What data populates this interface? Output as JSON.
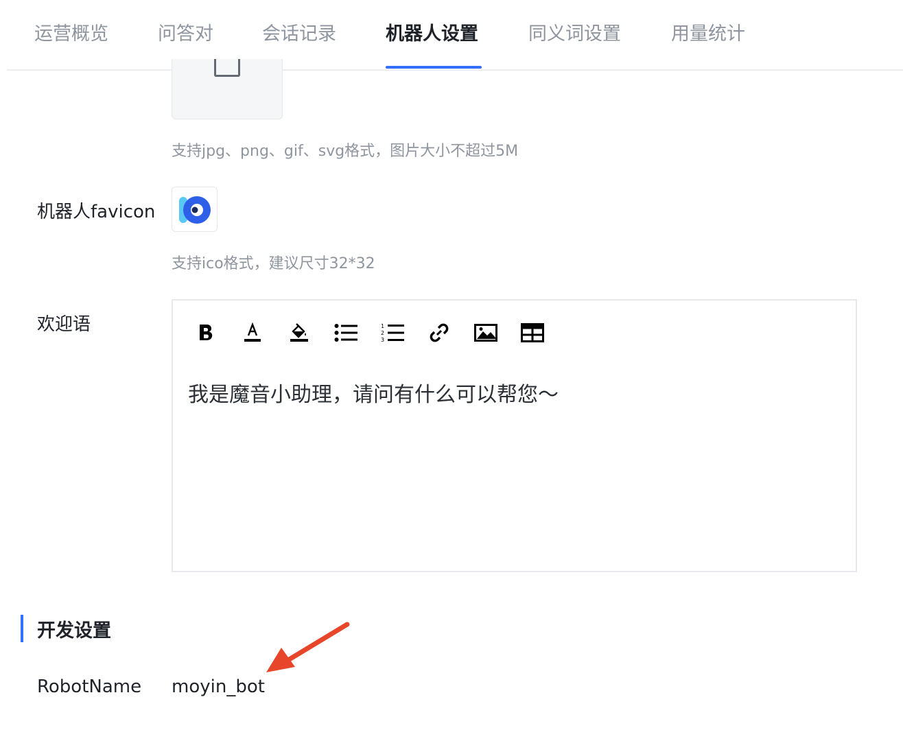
{
  "tabs": [
    {
      "label": "运营概览",
      "active": false
    },
    {
      "label": "问答对",
      "active": false
    },
    {
      "label": "会话记录",
      "active": false
    },
    {
      "label": "机器人设置",
      "active": true
    },
    {
      "label": "同义词设置",
      "active": false
    },
    {
      "label": "用量统计",
      "active": false
    }
  ],
  "avatar_upload": {
    "hint": "支持jpg、png、gif、svg格式，图片大小不超过5M"
  },
  "favicon": {
    "label": "机器人favicon",
    "hint": "支持ico格式，建议尺寸32*32"
  },
  "welcome": {
    "label": "欢迎语",
    "toolbar": [
      "bold-icon",
      "font-color-icon",
      "fill-color-icon",
      "bullet-list-icon",
      "numbered-list-icon",
      "link-icon",
      "image-icon",
      "table-icon"
    ],
    "content": "我是魔音小助理，请问有什么可以帮您～"
  },
  "dev_settings": {
    "title": "开发设置",
    "robot_name_label": "RobotName",
    "robot_name_value": "moyin_bot"
  },
  "colors": {
    "accent": "#3370ff",
    "annotation_arrow": "#e8462a",
    "muted_text": "#8f959e"
  }
}
